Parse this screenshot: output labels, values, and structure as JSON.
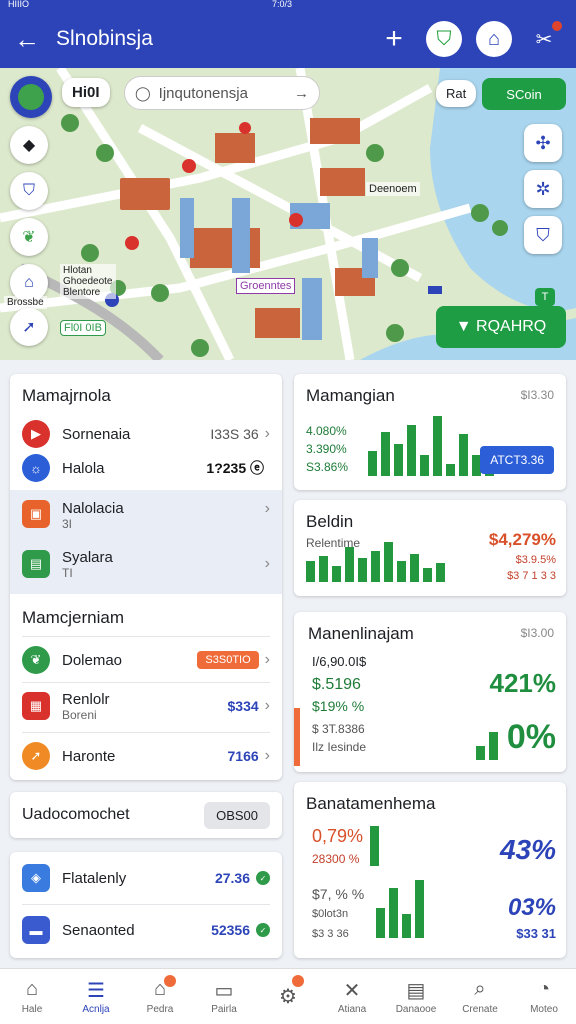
{
  "status": {
    "left": "HIIIO",
    "center": "7:0/3"
  },
  "appbar": {
    "back_glyph": "←",
    "title": "Slnobinsja",
    "plus_glyph": "+",
    "shield_glyph": "⛉",
    "chat_glyph": "⌂",
    "tools_glyph": "✂"
  },
  "map": {
    "chip_label": "Hi0I",
    "search_placeholder": "Ijnqutonensja",
    "search_arrow": "→",
    "btn_small_left": "Rat",
    "btn_small_right": "SCoin",
    "left_tag": "Fl0I 0IB",
    "label_a": "Deenoem",
    "label_b": "Groenntes",
    "label_c": "Hlotan\nGhoedeote\nBlentore",
    "left_caption": "Brossbe",
    "cta_label": "▼ RQAHRQ",
    "cta_badge": "T"
  },
  "left_card": {
    "header": "Mamajrnola",
    "rows": [
      {
        "label": "Sornenaia",
        "value": "I33S 36"
      },
      {
        "label": "Halola",
        "value": "1?235 ⓔ"
      },
      {
        "label": "Nalolacia",
        "sub": "3I"
      },
      {
        "label": "Syalara",
        "sub": "TI"
      }
    ],
    "section2": "Mamcjerniam",
    "rows2": [
      {
        "label": "Dolemao",
        "pill": "S3S0TIO"
      },
      {
        "label": "Renlolr",
        "sub": "Boreni",
        "value": "$334"
      },
      {
        "label": "Haronte",
        "value": "7166"
      }
    ]
  },
  "input_card": {
    "label": "Uadocomochet",
    "button": "OBS00"
  },
  "small_card": {
    "rows": [
      {
        "label": "Flatalenly",
        "value": "27.36"
      },
      {
        "label": "Senaonted",
        "value": "52356"
      }
    ]
  },
  "right_cards": [
    {
      "title": "Mamangian",
      "corner": "$I3.30",
      "m1": "4.080%",
      "m2": "3.390%",
      "m3": "S3.86%",
      "button": "ATCT3.36",
      "bars": [
        22,
        38,
        28,
        44,
        18,
        52,
        10,
        36,
        18,
        22
      ]
    },
    {
      "title": "Beldin",
      "sub": "Relentime",
      "big": "$4,279%",
      "m1": "$3.9.5%",
      "m2": "$3 7 1 3 3",
      "bars": [
        18,
        22,
        14,
        30,
        20,
        26,
        34,
        18,
        24,
        12,
        16
      ]
    },
    {
      "title": "Manenlinajam",
      "corner": "$I3.00",
      "m1": "I/6,90.0I$",
      "m2": "$.5196",
      "m3": "$19% %",
      "m4": "$ 3T.8386",
      "m5": "Ilz Iesinde",
      "big1": "421%",
      "big2": "0%"
    },
    {
      "title": "Banatamenhema",
      "m1": "0,79%",
      "m2": "28300 %",
      "m3": "$7, % %",
      "m4": "$0lot3n",
      "m5": "$3 3 36",
      "big1": "43%",
      "big2": "03%",
      "big3": "$33 31"
    }
  ],
  "tabs": [
    {
      "label": "Hale",
      "icon": "home-icon",
      "glyph": "⌂"
    },
    {
      "label": "Acnlja",
      "icon": "list-icon",
      "glyph": "☰"
    },
    {
      "label": "Pedra",
      "icon": "store-icon",
      "glyph": "⌂"
    },
    {
      "label": "Pairla",
      "icon": "folder-icon",
      "glyph": "▭"
    },
    {
      "label": "",
      "icon": "gear-icon",
      "glyph": "⚙"
    },
    {
      "label": "Atiana",
      "icon": "tools-icon",
      "glyph": "✕"
    },
    {
      "label": "Danaooe",
      "icon": "document-icon",
      "glyph": "▤"
    },
    {
      "label": "Crenate",
      "icon": "search-icon",
      "glyph": "⌕"
    },
    {
      "label": "Moteo",
      "icon": "user-icon",
      "glyph": "◔"
    }
  ],
  "colors": {
    "primary": "#2c44b8",
    "green": "#1f9d45",
    "orange": "#ef6c3a",
    "red": "#d9312b"
  }
}
